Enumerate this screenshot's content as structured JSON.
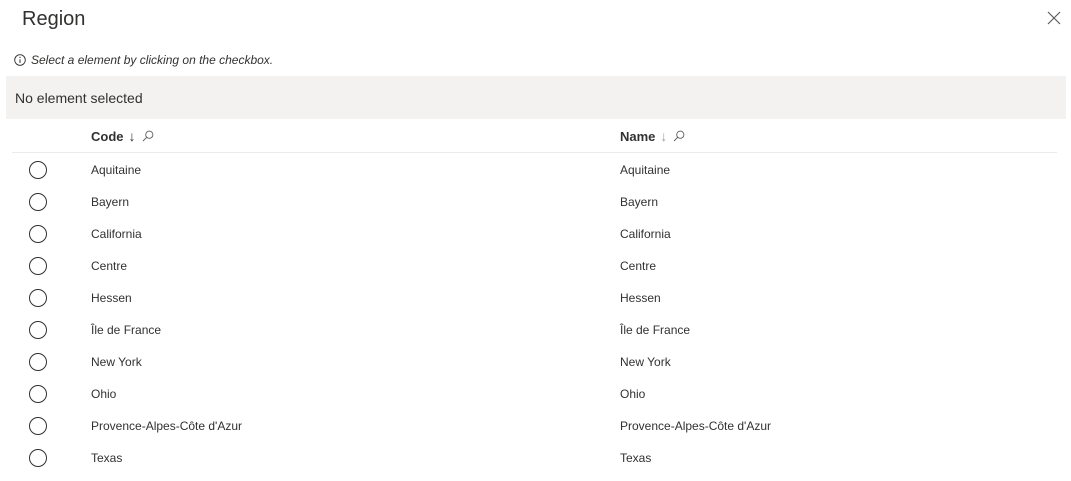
{
  "dialog": {
    "title": "Region",
    "close_icon": "close-icon",
    "hint": "Select a element by clicking on the checkbox.",
    "hint_icon": "info-icon",
    "selection_status": "No element selected"
  },
  "table": {
    "columns": [
      {
        "label": "Code",
        "sort_glyph": "↓",
        "sort_active": true
      },
      {
        "label": "Name",
        "sort_glyph": "↓",
        "sort_active": false
      }
    ],
    "rows": [
      {
        "code": "Aquitaine",
        "name": "Aquitaine"
      },
      {
        "code": "Bayern",
        "name": "Bayern"
      },
      {
        "code": "California",
        "name": "California"
      },
      {
        "code": "Centre",
        "name": "Centre"
      },
      {
        "code": "Hessen",
        "name": "Hessen"
      },
      {
        "code": "Île de France",
        "name": "Île de France"
      },
      {
        "code": "New York",
        "name": "New York"
      },
      {
        "code": "Ohio",
        "name": "Ohio"
      },
      {
        "code": "Provence-Alpes-Côte d'Azur",
        "name": "Provence-Alpes-Côte d'Azur"
      },
      {
        "code": "Texas",
        "name": "Texas"
      }
    ]
  },
  "colors": {
    "selection_bar_bg": "#f3f2f1",
    "text": "#323130",
    "divider": "#edebe9"
  }
}
